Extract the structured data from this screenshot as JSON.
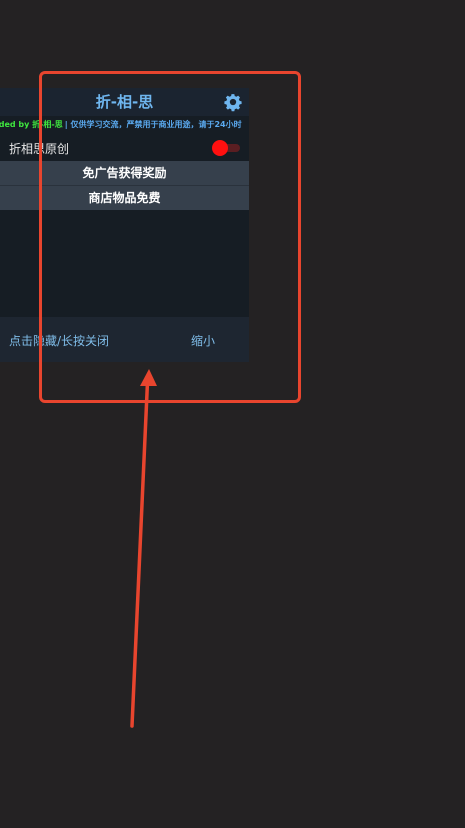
{
  "menu": {
    "title": "折-相-思",
    "settings_icon": "gear-icon",
    "credit": {
      "prefix": "dded by 折-相-思",
      "notice": "| 仅供学习交流，严禁用于商业用途，请于24小时"
    },
    "toggle": {
      "label": "折相思原创",
      "state": "on",
      "color": "#ff1010"
    },
    "features": [
      {
        "label": "免广告获得奖励"
      },
      {
        "label": "商店物品免费"
      }
    ],
    "footer": {
      "hide_close_label": "点击隐藏/长按关闭",
      "shrink_label": "缩小"
    }
  },
  "annotation": {
    "color": "#e8452e"
  }
}
